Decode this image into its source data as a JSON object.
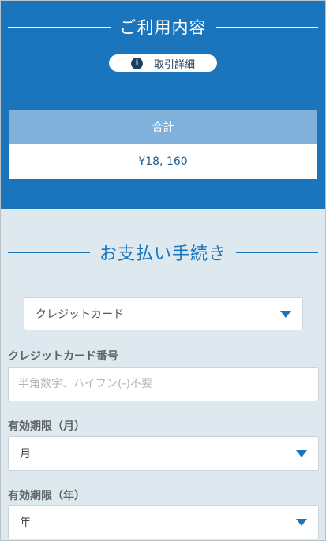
{
  "usage": {
    "title": "ご利用内容",
    "detail_button": "取引詳細",
    "detail_icon": "info-icon",
    "total_label": "合計",
    "total_value": "¥18, 160"
  },
  "payment": {
    "title": "お支払い手続き",
    "method_selected": "クレジットカード",
    "card_number_label": "クレジットカード番号",
    "card_number_placeholder": "半角数字、ハイフン(-)不要",
    "card_number_value": "",
    "expiry_month_label": "有効期限（月）",
    "expiry_month_selected": "月",
    "expiry_year_label": "有効期限（年）",
    "expiry_year_selected": "年"
  },
  "colors": {
    "primary": "#1a75bd",
    "background": "#dde9ee",
    "total_header": "#7fb1db"
  }
}
